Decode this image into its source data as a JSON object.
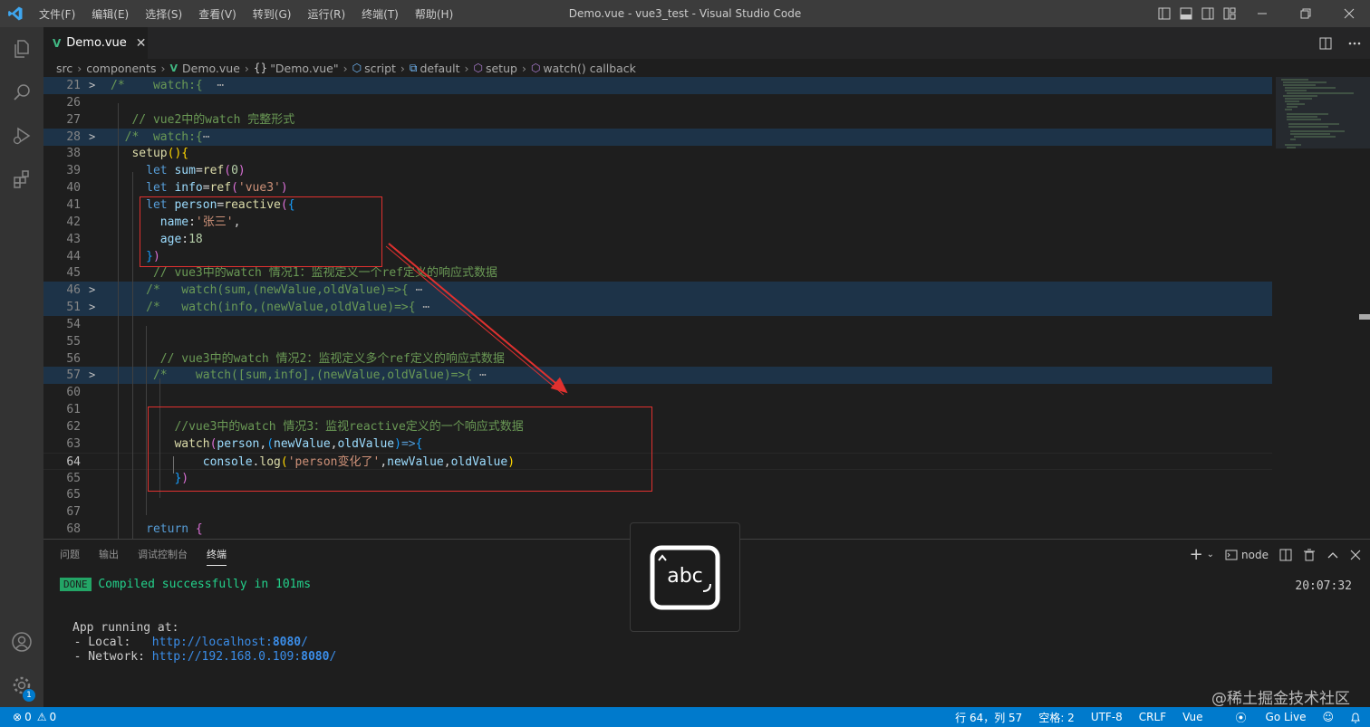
{
  "app": {
    "menu": [
      "文件(F)",
      "编辑(E)",
      "选择(S)",
      "查看(V)",
      "转到(G)",
      "运行(R)",
      "终端(T)",
      "帮助(H)"
    ],
    "window_title": "Demo.vue - vue3_test - Visual Studio Code"
  },
  "tab": {
    "label": "Demo.vue",
    "close": "✕"
  },
  "breadcrumbs": {
    "src": "src",
    "components": "components",
    "file": "Demo.vue",
    "object": "\"Demo.vue\"",
    "script": "script",
    "default": "default",
    "setup": "setup",
    "callback": "watch() callback"
  },
  "editor": {
    "current_line": "64",
    "lines": [
      {
        "n": "21",
        "fold": true,
        "chev": ">",
        "t": [
          [
            "cm",
            "/*    watch:{  "
          ],
          [
            "grey",
            "⋯"
          ]
        ]
      },
      {
        "n": "26",
        "t": []
      },
      {
        "n": "27",
        "t": [
          [
            "cm",
            "   // vue2中的watch 完整形式"
          ]
        ]
      },
      {
        "n": "28",
        "fold": true,
        "chev": ">",
        "t": [
          [
            "cm",
            "  /*  watch:{"
          ],
          [
            "grey",
            "⋯"
          ]
        ]
      },
      {
        "n": "38",
        "t": [
          [
            "fn",
            "   setup"
          ],
          [
            "br1",
            "()"
          ],
          [
            "br1",
            "{"
          ]
        ]
      },
      {
        "n": "39",
        "t": [
          [
            "kw",
            "     let "
          ],
          [
            "var",
            "sum"
          ],
          [
            "pn",
            "="
          ],
          [
            "fn",
            "ref"
          ],
          [
            "br2",
            "("
          ],
          [
            "num",
            "0"
          ],
          [
            "br2",
            ")"
          ]
        ]
      },
      {
        "n": "40",
        "t": [
          [
            "kw",
            "     let "
          ],
          [
            "var",
            "info"
          ],
          [
            "pn",
            "="
          ],
          [
            "fn",
            "ref"
          ],
          [
            "br2",
            "("
          ],
          [
            "str",
            "'vue3'"
          ],
          [
            "br2",
            ")"
          ]
        ]
      },
      {
        "n": "41",
        "t": [
          [
            "kw",
            "     let "
          ],
          [
            "var",
            "person"
          ],
          [
            "pn",
            "="
          ],
          [
            "fn",
            "reactive"
          ],
          [
            "br2",
            "("
          ],
          [
            "br3",
            "{"
          ]
        ]
      },
      {
        "n": "42",
        "t": [
          [
            "var",
            "       name"
          ],
          [
            "pn",
            ":"
          ],
          [
            "str",
            "'张三'"
          ],
          [
            "pn",
            ","
          ]
        ]
      },
      {
        "n": "43",
        "t": [
          [
            "var",
            "       age"
          ],
          [
            "pn",
            ":"
          ],
          [
            "num",
            "18"
          ]
        ]
      },
      {
        "n": "44",
        "t": [
          [
            "br3",
            "     }"
          ],
          [
            "br2",
            ")"
          ]
        ]
      },
      {
        "n": "45",
        "t": [
          [
            "cm",
            "      // vue3中的watch 情况1：监视定义一个ref定义的响应式数据"
          ]
        ]
      },
      {
        "n": "46",
        "fold": true,
        "chev": ">",
        "t": [
          [
            "cm",
            "     /*   watch(sum,(newValue,oldValue)=>{"
          ],
          [
            "grey",
            " ⋯"
          ]
        ]
      },
      {
        "n": "51",
        "fold": true,
        "chev": ">",
        "t": [
          [
            "cm",
            "     /*   watch(info,(newValue,oldValue)=>{"
          ],
          [
            "grey",
            " ⋯"
          ]
        ]
      },
      {
        "n": "54",
        "t": []
      },
      {
        "n": "55",
        "t": []
      },
      {
        "n": "56",
        "t": [
          [
            "cm",
            "       // vue3中的watch 情况2：监视定义多个ref定义的响应式数据"
          ]
        ]
      },
      {
        "n": "57",
        "fold": true,
        "chev": ">",
        "t": [
          [
            "cm",
            "      /*    watch([sum,info],(newValue,oldValue)=>{"
          ],
          [
            "grey",
            " ⋯"
          ]
        ]
      },
      {
        "n": "60",
        "t": []
      },
      {
        "n": "61",
        "t": []
      },
      {
        "n": "62",
        "t": [
          [
            "cm",
            "         //vue3中的watch 情况3：监视reactive定义的一个响应式数据"
          ]
        ]
      },
      {
        "n": "63",
        "t": [
          [
            "fn",
            "         watch"
          ],
          [
            "br2",
            "("
          ],
          [
            "var",
            "person"
          ],
          [
            "pn",
            ","
          ],
          [
            "br3",
            "("
          ],
          [
            "var",
            "newValue"
          ],
          [
            "pn",
            ","
          ],
          [
            "var",
            "oldValue"
          ],
          [
            "br3",
            ")"
          ],
          [
            "kw",
            "=>"
          ],
          [
            "br3",
            "{"
          ]
        ]
      },
      {
        "n": "64",
        "cur": true,
        "t": [
          [
            "var",
            "             console"
          ],
          [
            "pn",
            "."
          ],
          [
            "fn",
            "log"
          ],
          [
            "br1",
            "("
          ],
          [
            "str",
            "'person变化了'"
          ],
          [
            "pn",
            ","
          ],
          [
            "var",
            "newValue"
          ],
          [
            "pn",
            ","
          ],
          [
            "var",
            "oldValue"
          ],
          [
            "br1",
            ")"
          ]
        ]
      },
      {
        "n": "65",
        "t": [
          [
            "br3",
            "         }"
          ],
          [
            "br2",
            ")"
          ]
        ]
      },
      {
        "n": "65",
        "t": []
      },
      {
        "n": "67",
        "t": []
      },
      {
        "n": "68",
        "t": [
          [
            "kw",
            "     return "
          ],
          [
            "br2",
            "{"
          ]
        ]
      }
    ]
  },
  "panel": {
    "tabs": [
      "问题",
      "输出",
      "调试控制台",
      "终端"
    ],
    "active_tab": "终端",
    "terminal_name": "node",
    "done_badge": "DONE",
    "compiled": "Compiled successfully in 101ms",
    "timestamp": "20:07:32",
    "app_running": "App running at:",
    "local_label": "- Local:   ",
    "local_url": "http://localhost:",
    "local_port": "8080",
    "network_label": "- Network: ",
    "network_url": "http://192.168.0.109:",
    "network_port": "8080",
    "url_slash": "/"
  },
  "overlay": {
    "text": "abc"
  },
  "statusbar": {
    "errors": "0",
    "warnings": "0",
    "position": "行 64，列 57",
    "spaces": "空格: 2",
    "encoding": "UTF-8",
    "eol": "CRLF",
    "language": "Vue",
    "golive": "Go Live",
    "settings_badge": "1"
  },
  "watermark": "@稀土掘金技术社区",
  "colors": {
    "titlebar": "#3c3c3c",
    "activity_bar": "#333333",
    "editor_bg": "#1e1e1e",
    "status_bar": "#007acc",
    "annotation_red": "#e0312f"
  }
}
